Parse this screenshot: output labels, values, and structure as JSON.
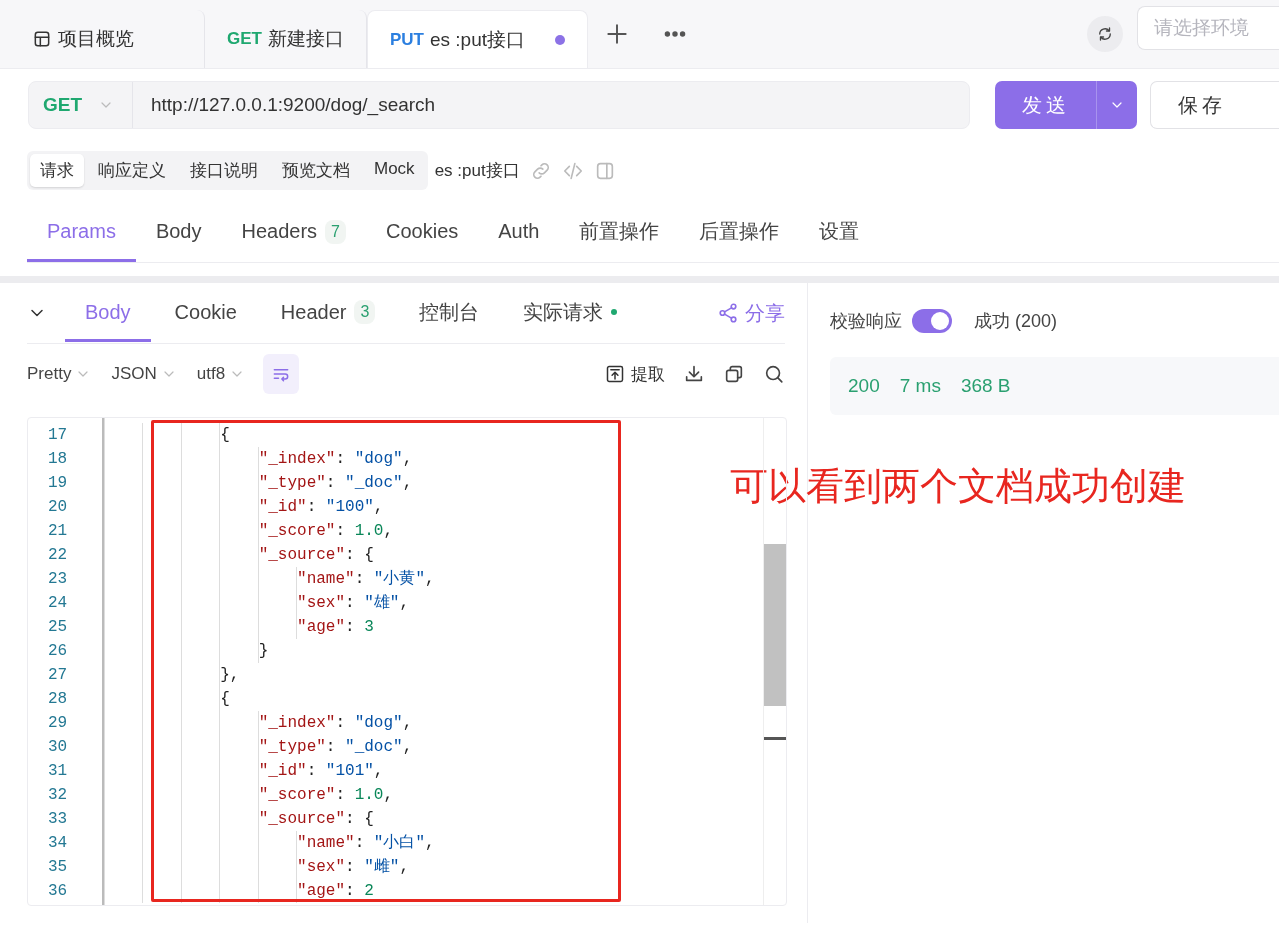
{
  "tabs": [
    {
      "kind": "overview",
      "label": "项目概览",
      "selected": false
    },
    {
      "kind": "api",
      "method": "GET",
      "color": "#1fa870",
      "label": "新建接口",
      "selected": false
    },
    {
      "kind": "api",
      "method": "PUT",
      "color": "#2b7fe0",
      "label": "es :put接口",
      "selected": true,
      "unsaved": true
    }
  ],
  "environment": {
    "placeholder": "请选择环境"
  },
  "request": {
    "method": "GET",
    "color": "#1fa870",
    "url": "http://127.0.0.1:9200/dog/_search",
    "send_label": "发送",
    "save_label": "保存"
  },
  "doc_tabs": [
    {
      "label": "请求",
      "selected": true
    },
    {
      "label": "响应定义",
      "selected": false
    },
    {
      "label": "接口说明",
      "selected": false
    },
    {
      "label": "预览文档",
      "selected": false
    },
    {
      "label": "Mock",
      "selected": false
    }
  ],
  "doc_name": "es :put接口",
  "param_tabs": [
    {
      "label": "Params",
      "selected": true
    },
    {
      "label": "Body",
      "selected": false
    },
    {
      "label": "Headers",
      "count": "7",
      "selected": false
    },
    {
      "label": "Cookies",
      "selected": false
    },
    {
      "label": "Auth",
      "selected": false
    },
    {
      "label": "前置操作",
      "selected": false
    },
    {
      "label": "后置操作",
      "selected": false
    },
    {
      "label": "设置",
      "selected": false
    }
  ],
  "response": {
    "tabs": [
      {
        "label": "Body",
        "selected": true
      },
      {
        "label": "Cookie",
        "selected": false
      },
      {
        "label": "Header",
        "count": "3",
        "selected": false
      },
      {
        "label": "控制台",
        "selected": false
      },
      {
        "label": "实际请求",
        "indicator": true,
        "selected": false
      }
    ],
    "share_label": "分享",
    "formats": [
      "Pretty",
      "JSON",
      "utf8"
    ],
    "extract_label": "提取",
    "lines": [
      {
        "n": "17",
        "tokens": [
          {
            "kind": "open",
            "text": "{"
          }
        ]
      },
      {
        "n": "18",
        "tokens": [
          {
            "kind": "key",
            "text": "\"_index\""
          },
          {
            "kind": "punct",
            "text": ": "
          },
          {
            "kind": "string",
            "text": "\"dog\""
          },
          {
            "kind": "punct",
            "text": ","
          }
        ]
      },
      {
        "n": "19",
        "tokens": [
          {
            "kind": "key",
            "text": "\"_type\""
          },
          {
            "kind": "punct",
            "text": ": "
          },
          {
            "kind": "string",
            "text": "\"_doc\""
          },
          {
            "kind": "punct",
            "text": ","
          }
        ]
      },
      {
        "n": "20",
        "tokens": [
          {
            "kind": "key",
            "text": "\"_id\""
          },
          {
            "kind": "punct",
            "text": ": "
          },
          {
            "kind": "string",
            "text": "\"100\""
          },
          {
            "kind": "punct",
            "text": ","
          }
        ]
      },
      {
        "n": "21",
        "tokens": [
          {
            "kind": "key",
            "text": "\"_score\""
          },
          {
            "kind": "punct",
            "text": ": "
          },
          {
            "kind": "number",
            "text": "1.0"
          },
          {
            "kind": "punct",
            "text": ","
          }
        ]
      },
      {
        "n": "22",
        "tokens": [
          {
            "kind": "key",
            "text": "\"_source\""
          },
          {
            "kind": "punct",
            "text": ": "
          },
          {
            "kind": "open",
            "text": "{"
          }
        ]
      },
      {
        "n": "23",
        "tokens": [
          {
            "kind": "key",
            "text": "\"name\""
          },
          {
            "kind": "punct",
            "text": ": "
          },
          {
            "kind": "string",
            "text": "\"小黄\""
          },
          {
            "kind": "punct",
            "text": ","
          }
        ]
      },
      {
        "n": "24",
        "tokens": [
          {
            "kind": "key",
            "text": "\"sex\""
          },
          {
            "kind": "punct",
            "text": ": "
          },
          {
            "kind": "string",
            "text": "\"雄\""
          },
          {
            "kind": "punct",
            "text": ","
          }
        ]
      },
      {
        "n": "25",
        "tokens": [
          {
            "kind": "key",
            "text": "\"age\""
          },
          {
            "kind": "punct",
            "text": ": "
          },
          {
            "kind": "number",
            "text": "3"
          }
        ]
      },
      {
        "n": "26",
        "tokens": [
          {
            "kind": "close",
            "text": "}"
          }
        ]
      },
      {
        "n": "27",
        "tokens": [
          {
            "kind": "close",
            "text": "}"
          },
          {
            "kind": "punct",
            "text": ","
          }
        ]
      },
      {
        "n": "28",
        "tokens": [
          {
            "kind": "open",
            "text": "{"
          }
        ]
      },
      {
        "n": "29",
        "tokens": [
          {
            "kind": "key",
            "text": "\"_index\""
          },
          {
            "kind": "punct",
            "text": ": "
          },
          {
            "kind": "string",
            "text": "\"dog\""
          },
          {
            "kind": "punct",
            "text": ","
          }
        ]
      },
      {
        "n": "30",
        "tokens": [
          {
            "kind": "key",
            "text": "\"_type\""
          },
          {
            "kind": "punct",
            "text": ": "
          },
          {
            "kind": "string",
            "text": "\"_doc\""
          },
          {
            "kind": "punct",
            "text": ","
          }
        ]
      },
      {
        "n": "31",
        "tokens": [
          {
            "kind": "key",
            "text": "\"_id\""
          },
          {
            "kind": "punct",
            "text": ": "
          },
          {
            "kind": "string",
            "text": "\"101\""
          },
          {
            "kind": "punct",
            "text": ","
          }
        ]
      },
      {
        "n": "32",
        "tokens": [
          {
            "kind": "key",
            "text": "\"_score\""
          },
          {
            "kind": "punct",
            "text": ": "
          },
          {
            "kind": "number",
            "text": "1.0"
          },
          {
            "kind": "punct",
            "text": ","
          }
        ]
      },
      {
        "n": "33",
        "tokens": [
          {
            "kind": "key",
            "text": "\"_source\""
          },
          {
            "kind": "punct",
            "text": ": "
          },
          {
            "kind": "open",
            "text": "{"
          }
        ]
      },
      {
        "n": "34",
        "tokens": [
          {
            "kind": "key",
            "text": "\"name\""
          },
          {
            "kind": "punct",
            "text": ": "
          },
          {
            "kind": "string",
            "text": "\"小白\""
          },
          {
            "kind": "punct",
            "text": ","
          }
        ]
      },
      {
        "n": "35",
        "tokens": [
          {
            "kind": "key",
            "text": "\"sex\""
          },
          {
            "kind": "punct",
            "text": ": "
          },
          {
            "kind": "string",
            "text": "\"雌\""
          },
          {
            "kind": "punct",
            "text": ","
          }
        ]
      },
      {
        "n": "36",
        "tokens": [
          {
            "kind": "key",
            "text": "\"age\""
          },
          {
            "kind": "punct",
            "text": ": "
          },
          {
            "kind": "number",
            "text": "2"
          }
        ]
      }
    ]
  },
  "validation": {
    "label": "校验响应",
    "on": true,
    "result": "成功 (200)",
    "status": "200",
    "time": "7 ms",
    "size": "368 B"
  },
  "annotation": {
    "text": "可以看到两个文档成功创建"
  }
}
